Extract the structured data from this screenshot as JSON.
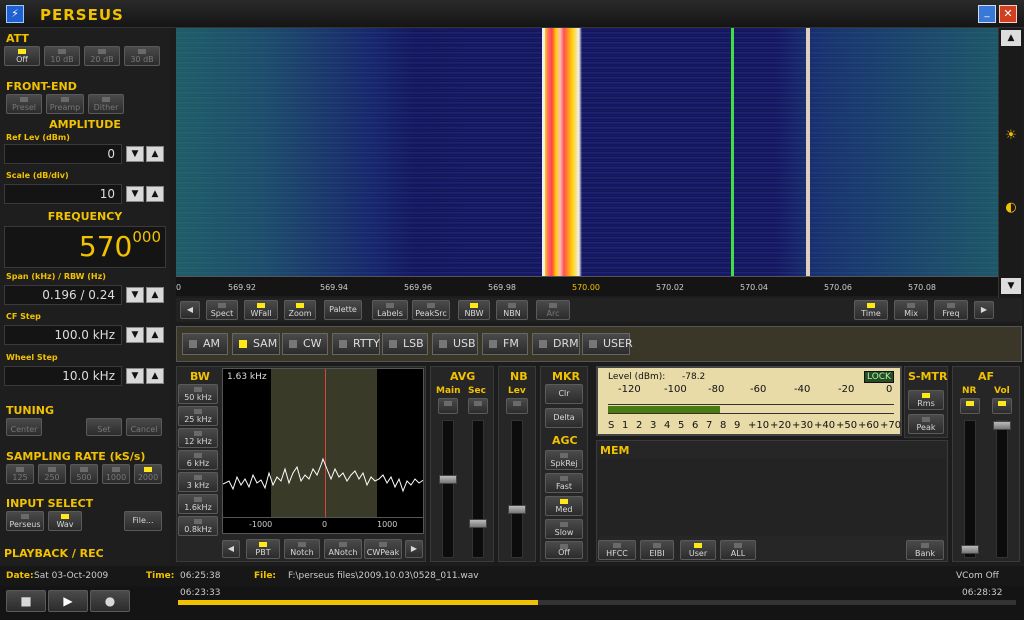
{
  "app": {
    "title": "PERSEUS"
  },
  "att": {
    "title": "ATT",
    "buttons": [
      "Off",
      "10 dB",
      "20 dB",
      "30 dB"
    ]
  },
  "frontend": {
    "title": "FRONT-END",
    "buttons": [
      "Presel",
      "Preamp",
      "Dither"
    ]
  },
  "amplitude": {
    "title": "AMPLITUDE",
    "ref_label": "Ref Lev (dBm)",
    "ref_value": "0",
    "scale_label": "Scale (dB/div)",
    "scale_value": "10"
  },
  "frequency": {
    "title": "FREQUENCY",
    "main": "570",
    "sub": "000",
    "span_label": "Span (kHz) / RBW (Hz)",
    "span_value": "0.196 / 0.24",
    "cfstep_label": "CF Step",
    "cfstep_value": "100.0 kHz",
    "wheel_label": "Wheel Step",
    "wheel_value": "10.0 kHz"
  },
  "tuning": {
    "title": "TUNING",
    "buttons": [
      "Center",
      "Set",
      "Cancel"
    ]
  },
  "sampling": {
    "title": "SAMPLING RATE (kS/s)",
    "buttons": [
      "125",
      "250",
      "500",
      "1000",
      "2000"
    ]
  },
  "input": {
    "title": "INPUT SELECT",
    "buttons": [
      "Perseus",
      "Wav",
      "File..."
    ]
  },
  "playback": {
    "title": "PLAYBACK / REC"
  },
  "spectrum": {
    "ticks": [
      "0",
      "569.92",
      "569.94",
      "569.96",
      "569.98",
      "570.00",
      "570.02",
      "570.04",
      "570.06",
      "570.08"
    ],
    "toolbar": [
      "Spect",
      "WFall",
      "Zoom",
      "Palette",
      "Labels",
      "PeakSrc",
      "NBW",
      "NBN",
      "Arc",
      "Time",
      "Mix",
      "Freq"
    ]
  },
  "modes": [
    "AM",
    "SAM",
    "CW",
    "RTTY",
    "LSB",
    "USB",
    "FM",
    "DRM",
    "USER"
  ],
  "bw": {
    "title": "BW",
    "buttons": [
      "50 kHz",
      "25 kHz",
      "12 kHz",
      "6 kHz",
      "3 kHz",
      "1.6kHz",
      "0.8kHz"
    ],
    "readout": "1.63 kHz",
    "ticks": [
      "-1000",
      "0",
      "1000"
    ],
    "bottom": [
      "PBT",
      "Notch",
      "ANotch",
      "CWPeak"
    ]
  },
  "avg": {
    "title": "AVG",
    "main": "Main",
    "sec": "Sec"
  },
  "nb": {
    "title": "NB",
    "lev": "Lev"
  },
  "mkr": {
    "title": "MKR",
    "buttons": [
      "Clr",
      "Delta"
    ]
  },
  "agc": {
    "title": "AGC",
    "buttons": [
      "SpkRej",
      "Fast",
      "Med",
      "Slow",
      "Off"
    ]
  },
  "smeter": {
    "level_label": "Level (dBm):",
    "level_value": "-78.2",
    "lock": "LOCK",
    "top_scale": [
      "-120",
      "-100",
      "-80",
      "-60",
      "-40",
      "-20",
      "0"
    ],
    "bottom_scale": [
      "S",
      "1",
      "2",
      "3",
      "4",
      "5",
      "6",
      "7",
      "8",
      "9",
      "+10",
      "+20",
      "+30",
      "+40",
      "+50",
      "+60",
      "+70"
    ],
    "level_fraction": 0.39
  },
  "smtr": {
    "title": "S-MTR",
    "buttons": [
      "Rms",
      "Peak"
    ]
  },
  "af": {
    "title": "AF",
    "nr": "NR",
    "vol": "Vol"
  },
  "mem": {
    "title": "MEM",
    "buttons": [
      "HFCC",
      "EIBI",
      "User",
      "ALL"
    ],
    "bank": "Bank"
  },
  "status": {
    "date_label": "Date:",
    "date_value": "Sat 03-Oct-2009",
    "time_label": "Time:",
    "time_value": "06:25:38",
    "file_label": "File:",
    "file_value": "F:\\perseus files\\2009.10.03\\0528_011.wav",
    "vcom": "VCom Off",
    "start": "06:23:33",
    "end": "06:28:32",
    "progress": 0.43
  },
  "colors": {
    "accent": "#f2c200",
    "led_on": "#ffe81a",
    "meter_bg": "#e8dba8"
  }
}
